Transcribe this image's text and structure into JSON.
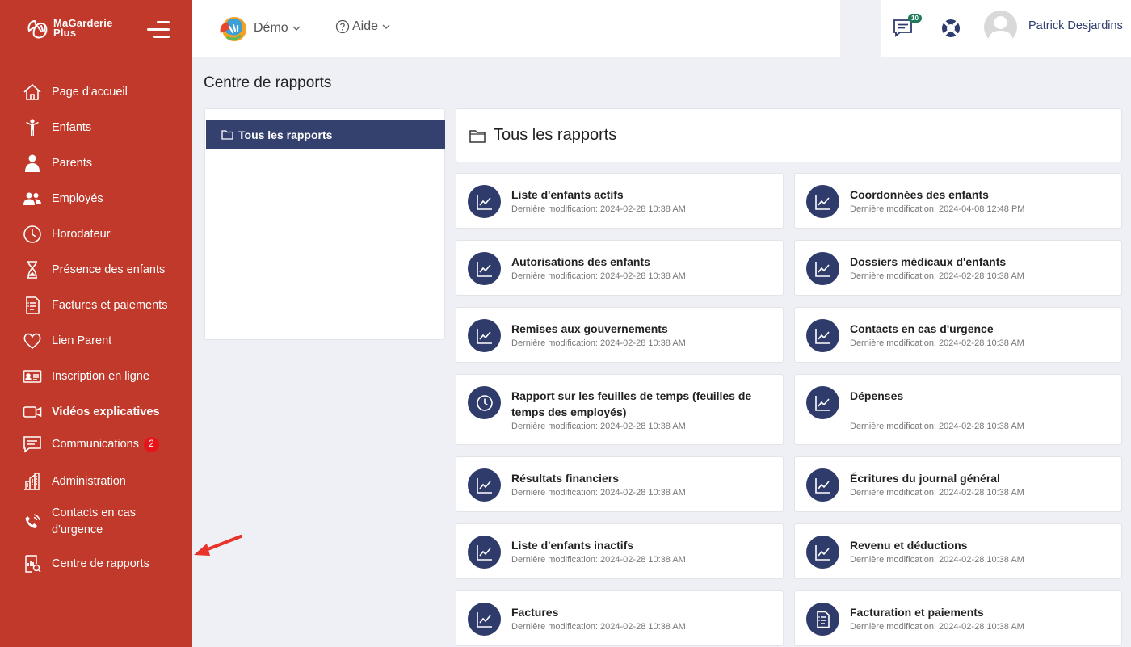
{
  "sidebar": {
    "logo_line1": "MaGarderie",
    "logo_line2": "Plus",
    "items": [
      {
        "label": "Page d'accueil",
        "icon": "home-icon"
      },
      {
        "label": "Enfants",
        "icon": "child-icon"
      },
      {
        "label": "Parents",
        "icon": "parent-icon"
      },
      {
        "label": "Employés",
        "icon": "employees-icon"
      },
      {
        "label": "Horodateur",
        "icon": "clock-icon"
      },
      {
        "label": "Présence des enfants",
        "icon": "hourglass-icon"
      },
      {
        "label": "Factures et paiements",
        "icon": "invoice-icon"
      },
      {
        "label": "Lien Parent",
        "icon": "heart-icon"
      },
      {
        "label": "Inscription en ligne",
        "icon": "id-card-icon"
      },
      {
        "label": "Vidéos explicatives",
        "icon": "video-icon"
      },
      {
        "label": "Communications",
        "icon": "chat-icon",
        "badge": "2"
      },
      {
        "label": "Administration",
        "icon": "building-icon"
      },
      {
        "label": "Contacts en cas d'urgence",
        "icon": "phone-icon"
      },
      {
        "label": "Centre de rapports",
        "icon": "report-icon"
      }
    ]
  },
  "topbar": {
    "org_label": "Démo",
    "help_label": "Aide",
    "messages_count": "10",
    "user_name": "Patrick Desjardins"
  },
  "page": {
    "title": "Centre de rapports",
    "folder": "Tous les rapports",
    "header": "Tous les rapports"
  },
  "reports": [
    {
      "name": "Liste d'enfants actifs",
      "date": "Dernière modification: 2024-02-28 10:38 AM",
      "icon": "chart-icon"
    },
    {
      "name": "Coordonnées des enfants",
      "date": "Dernière modification: 2024-04-08 12:48 PM",
      "icon": "chart-icon"
    },
    {
      "name": "Autorisations des enfants",
      "date": "Dernière modification: 2024-02-28 10:38 AM",
      "icon": "chart-icon"
    },
    {
      "name": "Dossiers médicaux d'enfants",
      "date": "Dernière modification: 2024-02-28 10:38 AM",
      "icon": "chart-icon"
    },
    {
      "name": "Remises aux gouvernements",
      "date": "Dernière modification: 2024-02-28 10:38 AM",
      "icon": "chart-icon"
    },
    {
      "name": "Contacts en cas d'urgence",
      "date": "Dernière modification: 2024-02-28 10:38 AM",
      "icon": "chart-icon"
    },
    {
      "name": "Rapport sur les feuilles de temps (feuilles de temps des employés)",
      "date": "Dernière modification: 2024-02-28 10:38 AM",
      "icon": "clock-icon"
    },
    {
      "name": "Dépenses",
      "date": "Dernière modification: 2024-02-28 10:38 AM",
      "icon": "chart-icon"
    },
    {
      "name": "Résultats financiers",
      "date": "Dernière modification: 2024-02-28 10:38 AM",
      "icon": "chart-icon"
    },
    {
      "name": "Écritures du journal général",
      "date": "Dernière modification: 2024-02-28 10:38 AM",
      "icon": "chart-icon"
    },
    {
      "name": "Liste d'enfants inactifs",
      "date": "Dernière modification: 2024-02-28 10:38 AM",
      "icon": "chart-icon"
    },
    {
      "name": "Revenu et déductions",
      "date": "Dernière modification: 2024-02-28 10:38 AM",
      "icon": "chart-icon"
    },
    {
      "name": "Factures",
      "date": "Dernière modification: 2024-02-28 10:38 AM",
      "icon": "chart-icon"
    },
    {
      "name": "Facturation et paiements",
      "date": "Dernière modification: 2024-02-28 10:38 AM",
      "icon": "invoice-icon"
    }
  ],
  "colors": {
    "sidebar": "#c0392b",
    "accent": "#34416e",
    "badge": "#e8141b"
  }
}
